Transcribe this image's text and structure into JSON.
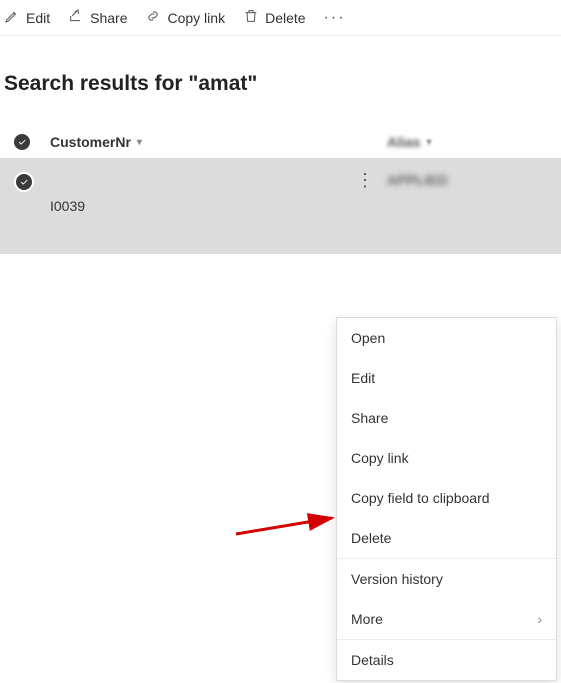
{
  "toolbar": {
    "edit": "Edit",
    "share": "Share",
    "copylink": "Copy link",
    "delete": "Delete"
  },
  "heading": "Search results for \"amat\"",
  "columns": {
    "customerNr": "CustomerNr",
    "alias": "Alias"
  },
  "rows": [
    {
      "customerNr": "I0039",
      "alias": "APPLIED"
    }
  ],
  "contextMenu": {
    "open": "Open",
    "edit": "Edit",
    "share": "Share",
    "copylink": "Copy link",
    "copyfield": "Copy field to clipboard",
    "delete": "Delete",
    "versionHistory": "Version history",
    "more": "More",
    "details": "Details"
  }
}
